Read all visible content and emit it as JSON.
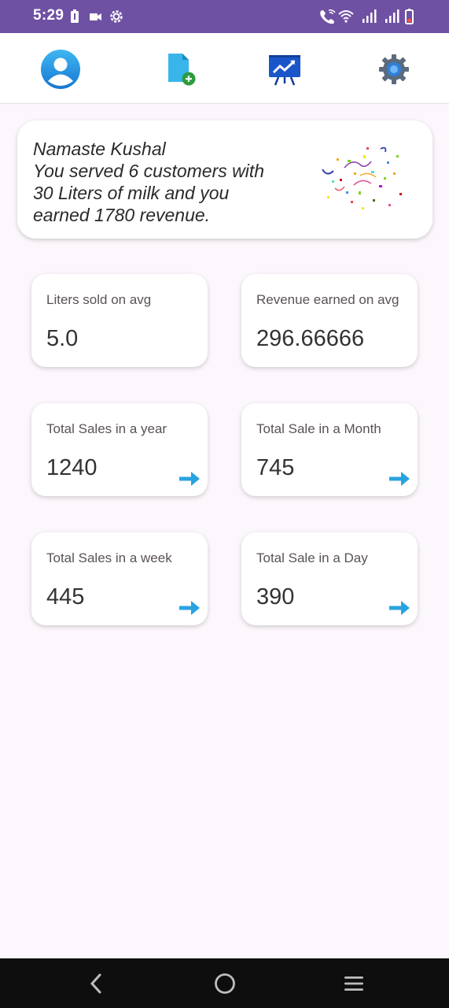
{
  "status_bar": {
    "time": "5:29",
    "left_icons": [
      "battery-saver-icon",
      "video-icon",
      "settings-gear-icon"
    ],
    "right_icons": [
      "wifi-calling-icon",
      "wifi-icon",
      "signal-icon",
      "signal-icon",
      "battery-icon"
    ]
  },
  "toolbar": {
    "buttons": [
      {
        "icon": "profile-avatar-icon"
      },
      {
        "icon": "add-document-icon"
      },
      {
        "icon": "sales-chart-icon"
      },
      {
        "icon": "settings-gear-icon"
      }
    ]
  },
  "greeting": {
    "line1": "Namaste Kushal",
    "line2": "You served 6 customers with",
    "line3": "30 Liters of milk and you",
    "line4": "earned 1780 revenue."
  },
  "stats": {
    "liters_avg": {
      "label": "Liters sold on avg",
      "value": "5.0"
    },
    "revenue_avg": {
      "label": "Revenue earned on avg",
      "value": "296.66666"
    },
    "year": {
      "label": "Total Sales in a year",
      "value": "1240"
    },
    "month": {
      "label": "Total Sale in a Month",
      "value": "745"
    },
    "week": {
      "label": "Total Sales in a week",
      "value": "445"
    },
    "day": {
      "label": "Total Sale in a Day",
      "value": "390"
    }
  },
  "colors": {
    "status_bar": "#6f51a3",
    "accent_arrow": "#29a3e0",
    "background": "#fcf7fc"
  },
  "nav_bar": {
    "buttons": [
      "back-icon",
      "home-icon",
      "recents-menu-icon"
    ]
  }
}
